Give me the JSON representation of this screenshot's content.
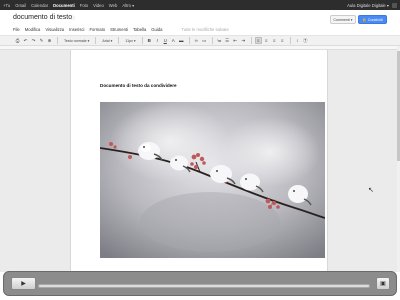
{
  "topbar": {
    "links": [
      "+Tu",
      "Gmail",
      "Calendar",
      "Documenti",
      "Foto",
      "Video",
      "Web",
      "Altro ▾"
    ],
    "active_index": 3,
    "account": "Aula Digitale Digitale ▾"
  },
  "document": {
    "title": "documento di testo",
    "body_text": "Documento di testo da condividere"
  },
  "header": {
    "comments_label": "Commenti ▾",
    "share_label": "Condividi",
    "share_color": "#4a8af4"
  },
  "menubar": {
    "items": [
      "File",
      "Modifica",
      "Visualizza",
      "Inserisci",
      "Formato",
      "Strumenti",
      "Tabella",
      "Guida"
    ],
    "saved_status": "Tutte le modifiche salvate"
  },
  "toolbar": {
    "style": "Testo normale ▾",
    "font": "Arial ▾",
    "size": "11px ▾"
  },
  "player": {
    "play_icon": "play-icon",
    "progress": 0
  },
  "image": {
    "subject": "birds-on-branch-photo"
  }
}
